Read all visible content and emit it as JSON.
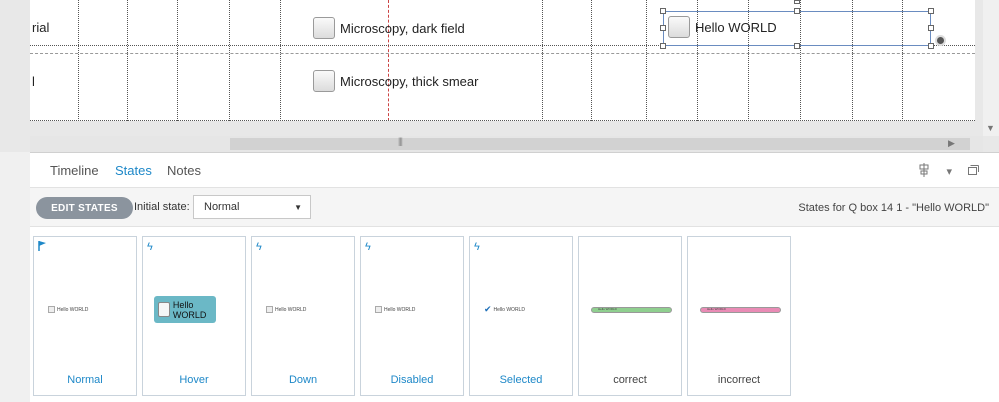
{
  "canvas": {
    "rows": [
      {
        "label": "rial",
        "option": "Microscopy, dark field"
      },
      {
        "label": "l",
        "option": "Microscopy, thick smear"
      }
    ],
    "selected_object": {
      "label": "Hello WORLD"
    }
  },
  "panel": {
    "tabs": [
      {
        "label": "Timeline",
        "active": false
      },
      {
        "label": "States",
        "active": true
      },
      {
        "label": "Notes",
        "active": false
      }
    ],
    "toolbar": {
      "edit_states_label": "EDIT STATES",
      "initial_state_label": "Initial state:",
      "initial_state_value": "Normal",
      "states_for": "States for Q box 14  1 - \"Hello WORLD\""
    },
    "states": [
      {
        "label": "Normal",
        "marker": "flag-icon",
        "preview": "Hello WORLD"
      },
      {
        "label": "Hover",
        "marker": "lightning-icon",
        "preview": "Hello WORLD"
      },
      {
        "label": "Down",
        "marker": "lightning-icon",
        "preview": "Hello WORLD"
      },
      {
        "label": "Disabled",
        "marker": "lightning-icon",
        "preview": "Hello WORLD"
      },
      {
        "label": "Selected",
        "marker": "lightning-icon",
        "preview": "Hello WORLD"
      },
      {
        "label": "correct",
        "marker": "",
        "preview": "Hello WORLD"
      },
      {
        "label": "incorrect",
        "marker": "",
        "preview": "Hello WORLD"
      }
    ]
  },
  "colors": {
    "accent": "#1e88c8",
    "correct_bar": "#8fcf8f",
    "incorrect_bar": "#e98bb5",
    "hover_fill": "#6bb8c6"
  }
}
